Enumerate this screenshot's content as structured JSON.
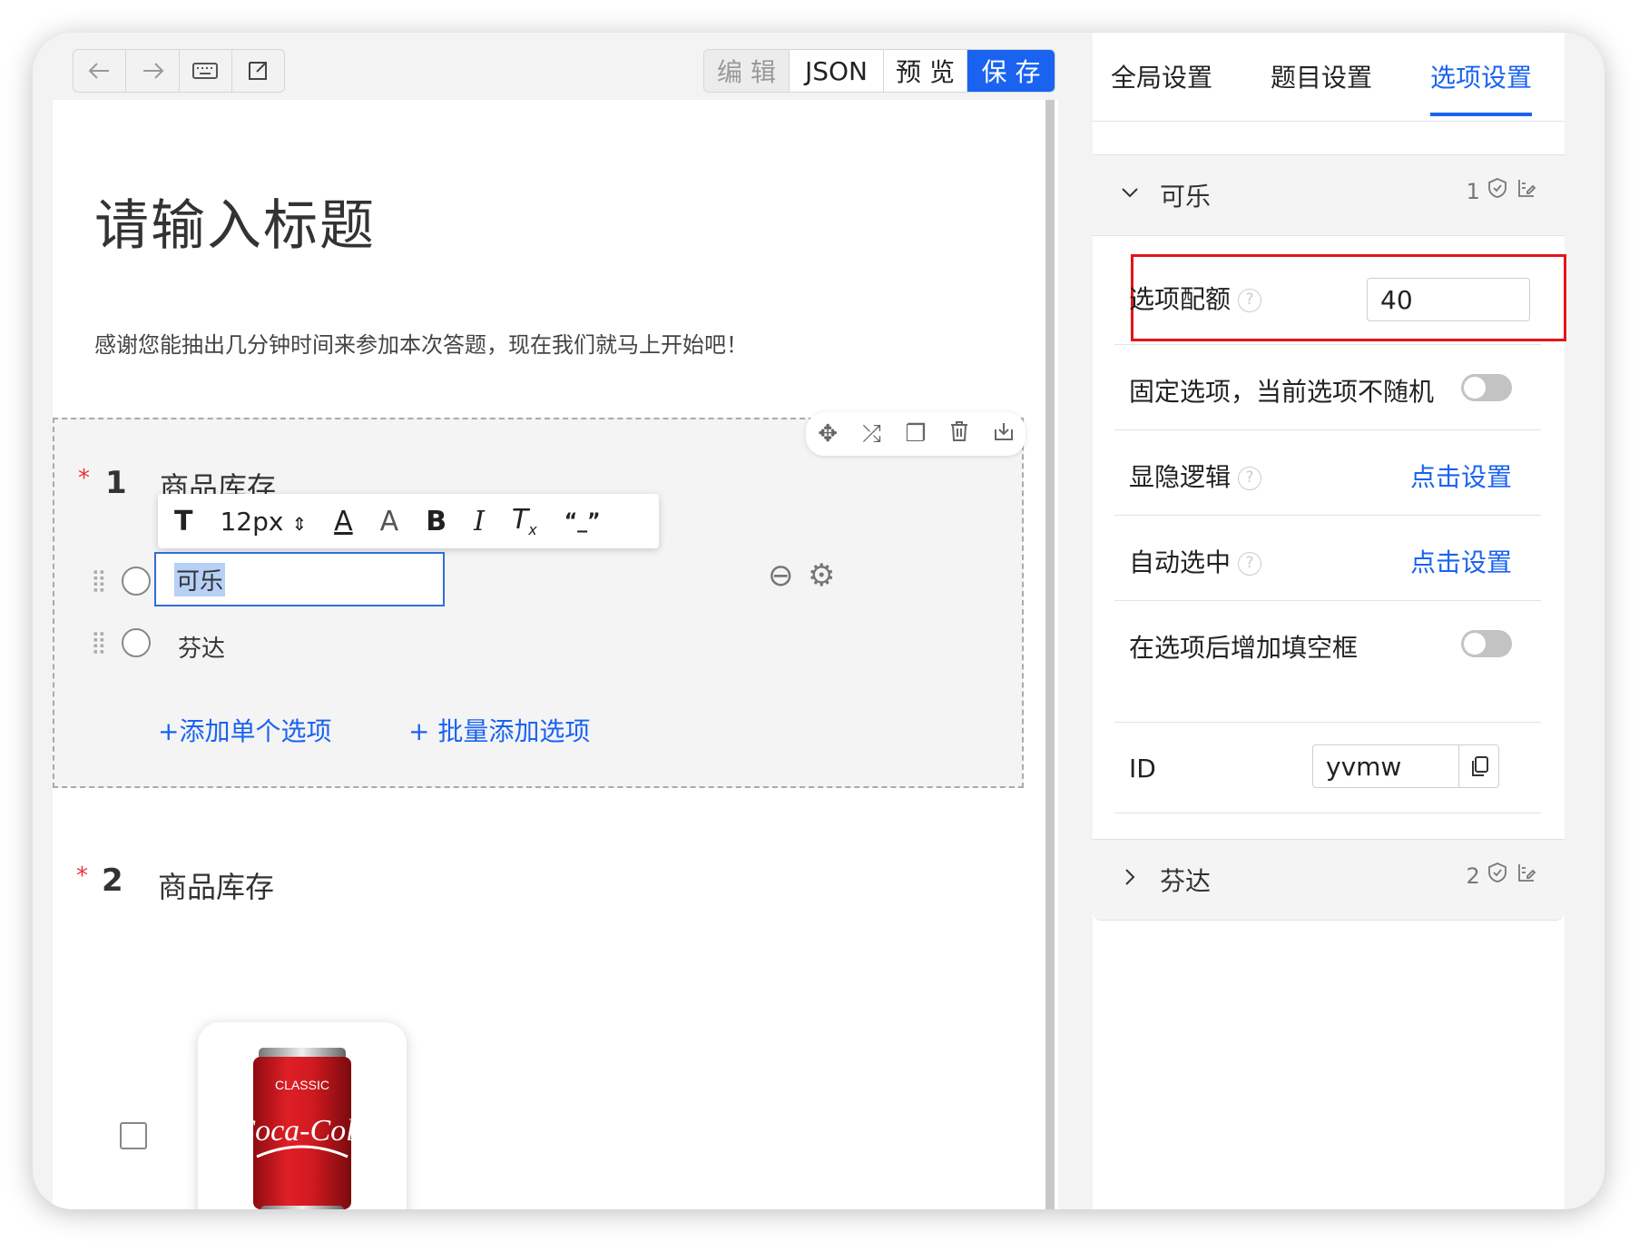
{
  "toolbar": {
    "undo_icon": "undo-icon",
    "redo_icon": "redo-icon",
    "keyboard_icon": "keyboard-icon",
    "export_icon": "export-icon",
    "modes": {
      "edit": "编 辑",
      "json": "JSON",
      "preview": "预 览",
      "save": "保 存"
    }
  },
  "survey": {
    "title": "请输入标题",
    "description": "感谢您能抽出几分钟时间来参加本次答题，现在我们就马上开始吧！"
  },
  "question1": {
    "required_mark": "*",
    "number": "1",
    "title": "商品库存",
    "rich_text_toolbar": {
      "font_size": "12px"
    },
    "options": [
      {
        "label": "可乐"
      },
      {
        "label": "芬达"
      }
    ],
    "add_single": "+添加单个选项",
    "add_batch": "+ 批量添加选项"
  },
  "question2": {
    "required_mark": "*",
    "number": "2",
    "title": "商品库存",
    "image_text_top": "CLASSIC",
    "image_text_logo": "Coca-Cola"
  },
  "panel": {
    "tabs": [
      "全局设置",
      "题目设置",
      "选项设置"
    ],
    "active_tab": "选项设置",
    "option1": {
      "name": "可乐",
      "meta_count": "1",
      "quota_label": "选项配额",
      "quota_value": "40",
      "fixed_label": "固定选项，当前选项不随机",
      "visibility_label": "显隐逻辑",
      "visibility_link": "点击设置",
      "autoselect_label": "自动选中",
      "autoselect_link": "点击设置",
      "fill_blank_label": "在选项后增加填空框",
      "id_label": "ID",
      "id_value": "yvmw"
    },
    "option2": {
      "name": "芬达",
      "meta_count": "2"
    }
  },
  "colors": {
    "accent": "#1a63f0",
    "highlight": "#e5141b"
  }
}
